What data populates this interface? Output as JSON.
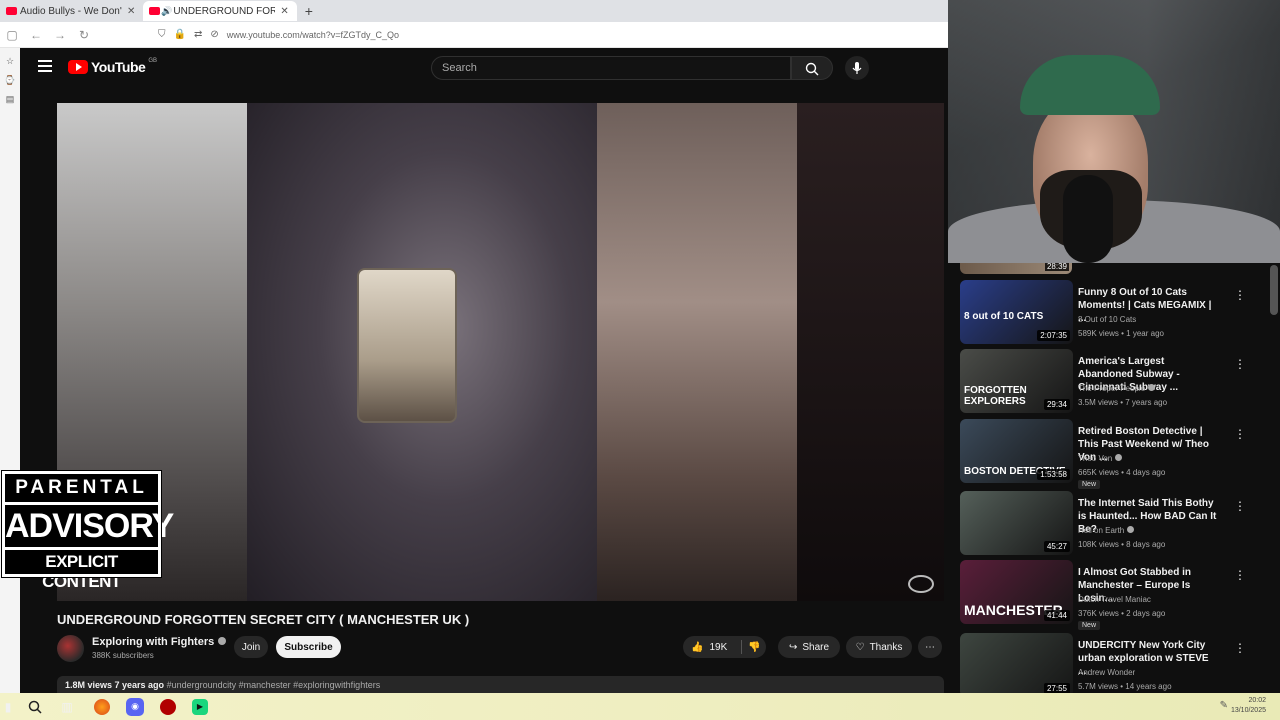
{
  "browser": {
    "tabs": [
      {
        "title": "Audio Bullys - We Don't Care (C",
        "active": false
      },
      {
        "title": "UNDERGROUND FORGOTT",
        "active": true
      }
    ],
    "url": "www.youtube.com/watch?v=fZGTdy_C_Qo"
  },
  "youtube": {
    "logo_text": "YouTube",
    "logo_country": "GB",
    "search_placeholder": "Search",
    "video_title": "UNDERGROUND FORGOTTEN SECRET CITY ( MANCHESTER UK )",
    "channel": {
      "name": "Exploring with Fighters",
      "subscribers": "388K subscribers"
    },
    "join_label": "Join",
    "subscribe_label": "Subscribe",
    "likes": "19K",
    "share_label": "Share",
    "thanks_label": "Thanks",
    "description": {
      "views_date": "1.8M views  7 years ago",
      "tags": "#undergroundcity #manchester #exploringwithfighters"
    }
  },
  "overlay": {
    "line1": "PARENTAL",
    "line2": "ADVISORY",
    "line3": "EXPLICIT CONTENT"
  },
  "sidebar": {
    "top_partial_duration": "28:39",
    "items": [
      {
        "title": "Funny 8 Out of 10 Cats Moments! | Cats MEGAMIX | ...",
        "channel": "8 Out of 10 Cats",
        "verified": false,
        "meta": "589K views • 1 year ago",
        "duration": "2:07:35",
        "thumb_text": "8 out of 10 CATS",
        "new": false,
        "thumb_color": "#2a3e8a"
      },
      {
        "title": "America's Largest Abandoned Subway - Cincinnati Subway ...",
        "channel": "The Proper People",
        "verified": true,
        "meta": "3.5M views • 7 years ago",
        "duration": "29:34",
        "thumb_text": "FORGOTTEN EXPLORERS",
        "new": false,
        "thumb_color": "#4a4c48"
      },
      {
        "title": "Retired Boston Detective | This Past Weekend w/ Theo Von ...",
        "channel": "Theo Von",
        "verified": true,
        "meta": "665K views • 4 days ago",
        "duration": "1:53:58",
        "thumb_text": "BOSTON DETECTIVE",
        "new": true,
        "thumb_color": "#3b4a5a"
      },
      {
        "title": "The Internet Said This Bothy is Haunted... How BAD Can It Be?",
        "channel": "Hell on Earth",
        "verified": true,
        "meta": "108K views • 8 days ago",
        "duration": "45:27",
        "thumb_text": "",
        "new": false,
        "thumb_color": "#55605a"
      },
      {
        "title": "I Almost Got Stabbed in Manchester – Europe Is Losin...",
        "channel": "Dutch Travel Maniac",
        "verified": false,
        "meta": "376K views • 2 days ago",
        "duration": "41:44",
        "thumb_text": "MANCHESTER",
        "new": true,
        "thumb_color": "#5a1e3a"
      },
      {
        "title": "UNDERCITY New York City urban exploration w STEVE ...",
        "channel": "Andrew Wonder",
        "verified": false,
        "meta": "5.7M views • 14 years ago",
        "duration": "27:55",
        "thumb_text": "",
        "new": false,
        "thumb_color": "#3e4640"
      }
    ],
    "new_label": "New"
  },
  "taskbar": {
    "time": "20:02",
    "date": "13/10/2025"
  }
}
